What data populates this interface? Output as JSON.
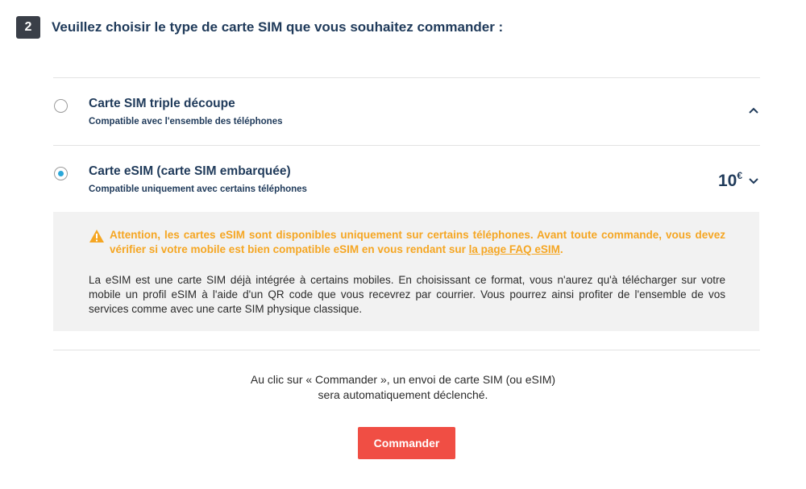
{
  "step": {
    "number": "2",
    "title": "Veuillez choisir le type de carte SIM que vous souhaitez commander :"
  },
  "options": [
    {
      "title": "Carte SIM triple découpe",
      "subtitle": "Compatible avec l'ensemble des téléphones",
      "selected": false,
      "chevron": "chevron-up-icon"
    },
    {
      "title": "Carte eSIM (carte SIM embarquée)",
      "subtitle": "Compatible uniquement avec certains téléphones",
      "selected": true,
      "price_amount": "10",
      "price_currency": "€",
      "chevron": "chevron-down-icon"
    }
  ],
  "info": {
    "warning_icon": "warning-icon",
    "warning_text": "Attention, les cartes eSIM sont disponibles uniquement sur certains téléphones. Avant toute commande, vous devez vérifier si votre mobile est bien compatible eSIM en vous rendant sur ",
    "warning_link": "la page FAQ eSIM",
    "warning_end": ".",
    "body": "La eSIM est une carte SIM déjà intégrée à certains mobiles. En choisissant ce format, vous n'aurez qu'à télécharger sur votre mobile un profil eSIM à l'aide d'un QR code que vous recevrez par courrier. Vous pourrez ainsi profiter de l'ensemble de vos services comme avec une carte SIM physique classique."
  },
  "footer": {
    "line1": "Au clic sur « Commander », un envoi de carte SIM (ou eSIM)",
    "line2": "sera automatiquement déclenché.",
    "button_label": "Commander"
  },
  "colors": {
    "accent_red": "#f04e44",
    "radio_selected": "#2aa7d9",
    "warning": "#f5a623",
    "title_navy": "#1f3a5a"
  }
}
